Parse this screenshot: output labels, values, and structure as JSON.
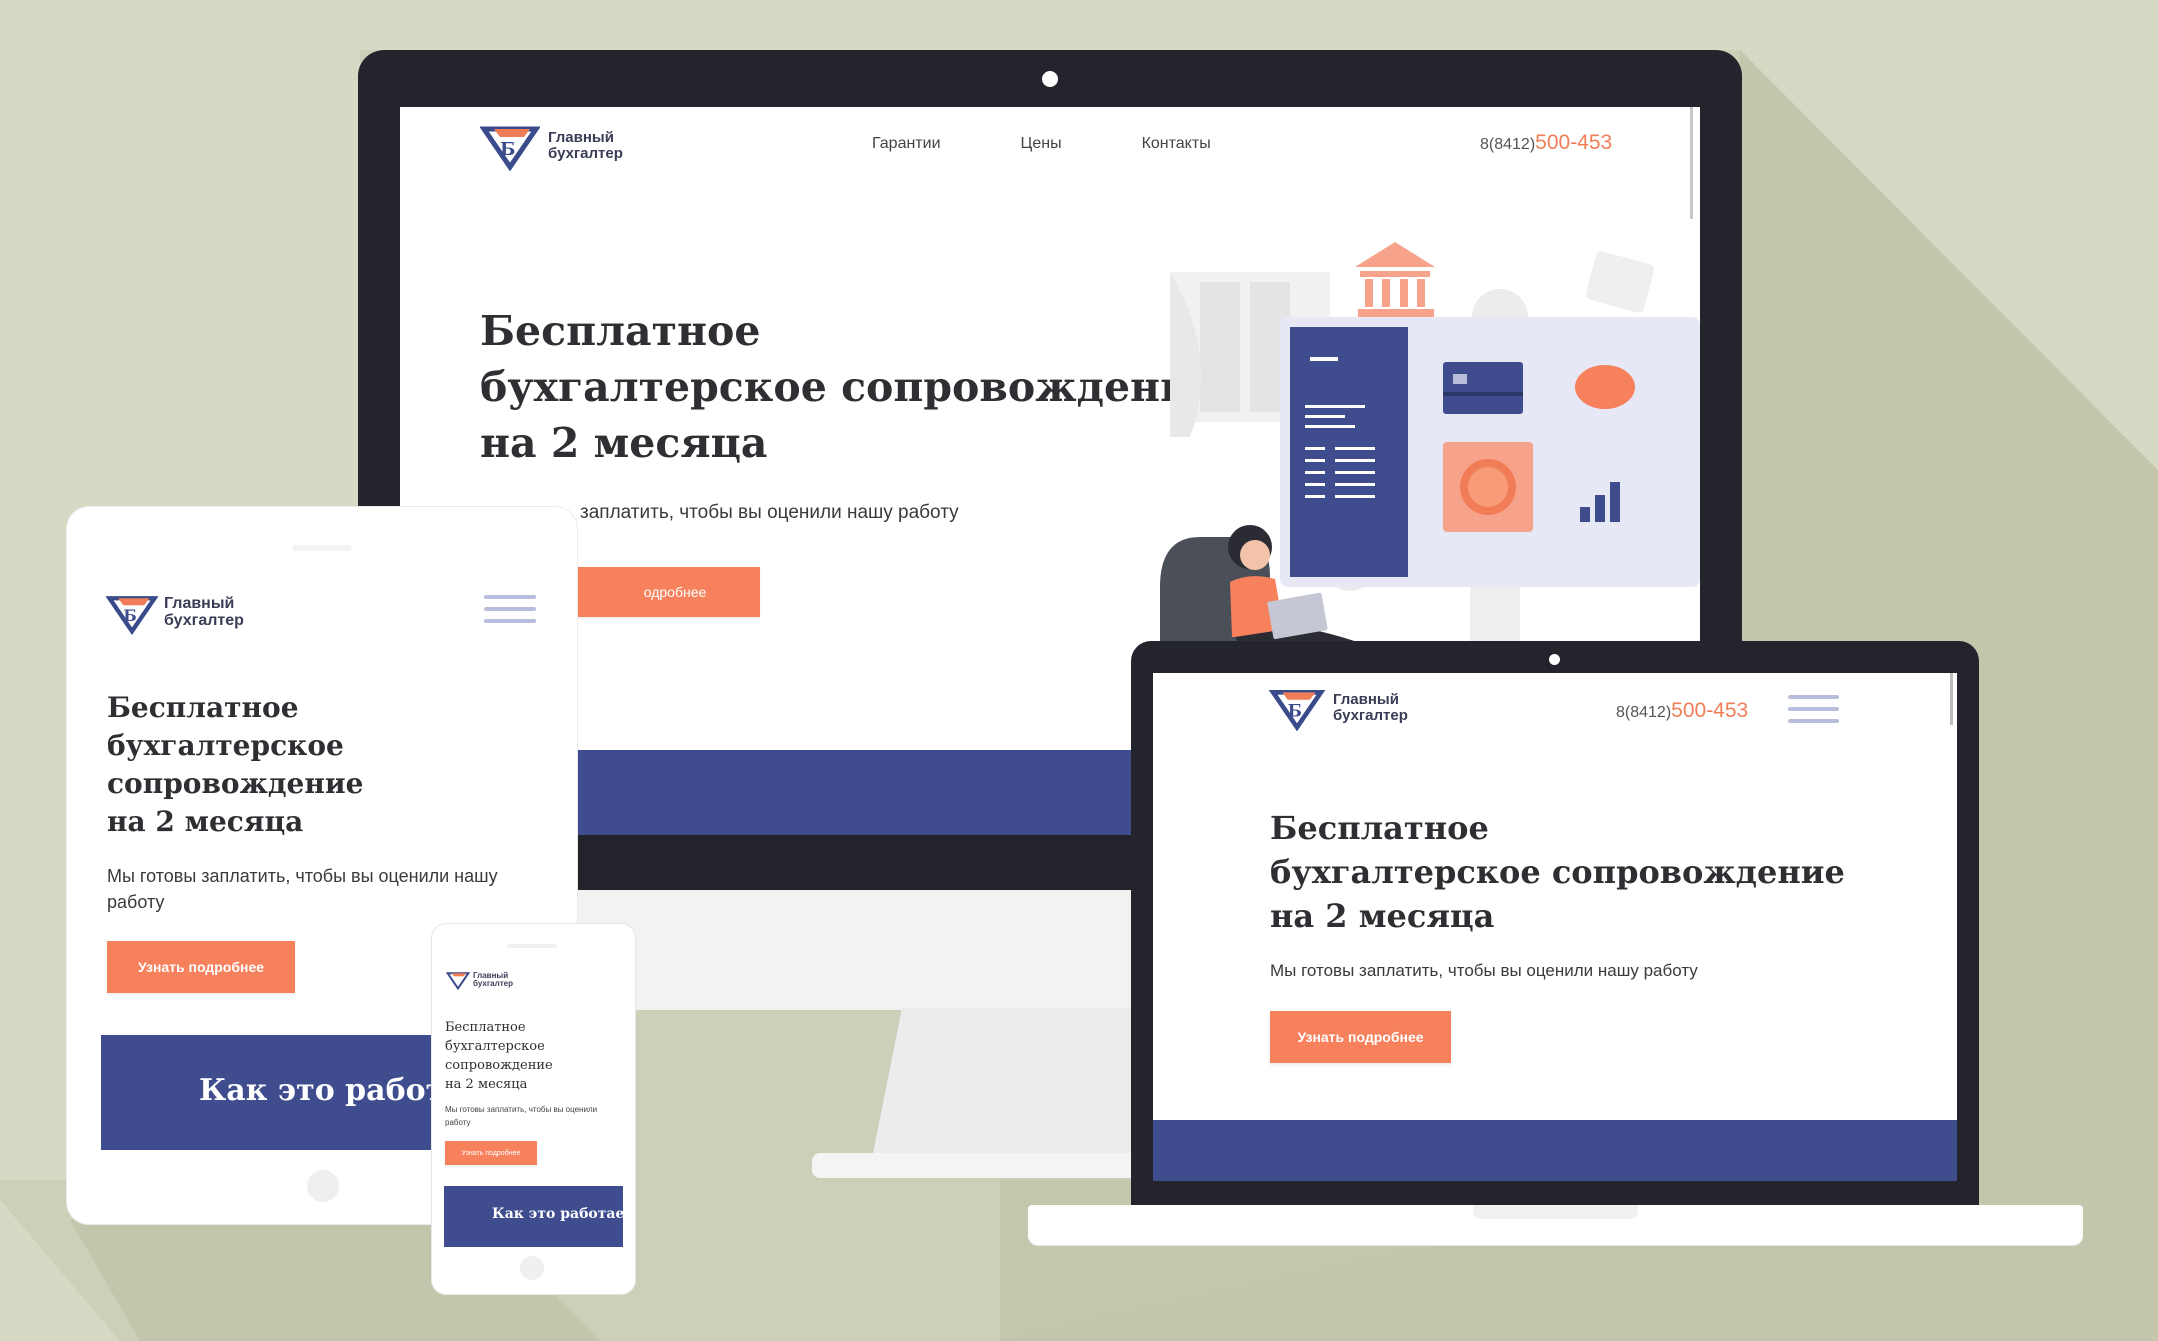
{
  "brand": {
    "name_line1": "Главный",
    "name_line2": "бухгалтер",
    "name_line2_alt": "бухгалтер",
    "logo_icon": "diamond-gb-logo-icon"
  },
  "nav": {
    "items": [
      "Гарантии",
      "Цены",
      "Контакты"
    ]
  },
  "phone": {
    "prefix": "8(8412)",
    "number": "500-453"
  },
  "hero": {
    "title_line1": "Бесплатное",
    "title_line2": "бухгалтерское сопровождение",
    "title_line3": "на 2 месяца",
    "title_tablet_l2": "бухгалтерское",
    "title_tablet_l3": "сопровождение",
    "subtitle": "Мы готовы заплатить, чтобы вы оценили нашу работу",
    "subtitle_partial": "заплатить, чтобы вы оценили нашу работу",
    "subtitle_tablet_l1": "Мы готовы заплатить, чтобы вы оценили нашу",
    "subtitle_tablet_l2": "работу",
    "subtitle_phone_l1": "Мы готовы заплатить, чтобы вы оценили",
    "subtitle_phone_l2": "работу",
    "cta_label": "Узнать подробнее",
    "cta_partial": "одробнее"
  },
  "section2": {
    "title": "Как это работает"
  },
  "colors": {
    "accent": "#f7805d",
    "brand_blue": "#3f4d8f",
    "background": "#d6dac4",
    "device_frame": "#25262e"
  }
}
